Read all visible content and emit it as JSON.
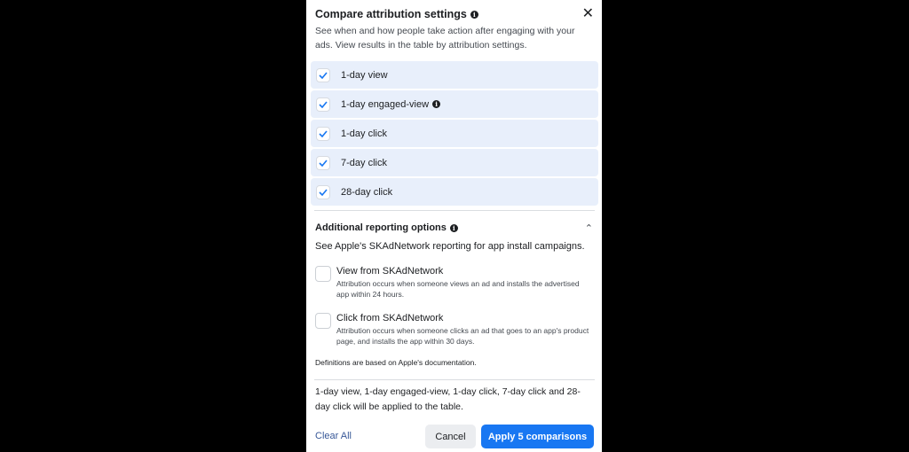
{
  "dialog": {
    "title": "Compare attribution settings",
    "description": "See when and how people take action after engaging with your ads. View results in the table by attribution settings.",
    "close_icon": "close-icon",
    "colors": {
      "accent": "#1877f2",
      "option_bg": "#e8effb",
      "link": "#385898"
    }
  },
  "options": [
    {
      "label": "1-day view",
      "checked": true,
      "info": false
    },
    {
      "label": "1-day engaged-view",
      "checked": true,
      "info": true
    },
    {
      "label": "1-day click",
      "checked": true,
      "info": false
    },
    {
      "label": "7-day click",
      "checked": true,
      "info": false
    },
    {
      "label": "28-day click",
      "checked": true,
      "info": false
    }
  ],
  "additional": {
    "title": "Additional reporting options",
    "expanded": true,
    "description": "See Apple's SKAdNetwork reporting for app install campaigns.",
    "items": [
      {
        "label": "View from SKAdNetwork",
        "description": "Attribution occurs when someone views an ad and installs the advertised app within 24 hours.",
        "checked": false
      },
      {
        "label": "Click from SKAdNetwork",
        "description": "Attribution occurs when someone clicks an ad that goes to an app's product page, and installs the app within 30 days.",
        "checked": false
      }
    ],
    "definitions_note": "Definitions are based on Apple's documentation."
  },
  "summary": "1-day view, 1-day engaged-view, 1-day click, 7-day click and 28-day click will be applied to the table.",
  "footer": {
    "clear_label": "Clear All",
    "cancel_label": "Cancel",
    "apply_label": "Apply 5 comparisons"
  }
}
